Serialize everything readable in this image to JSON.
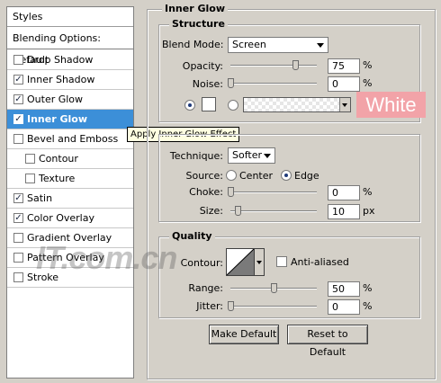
{
  "sidebar": {
    "header": "Styles",
    "blending": "Blending Options: Default",
    "items": [
      {
        "label": "Drop Shadow",
        "checked": false
      },
      {
        "label": "Inner Shadow",
        "checked": true
      },
      {
        "label": "Outer Glow",
        "checked": true
      },
      {
        "label": "Inner Glow",
        "checked": true,
        "selected": true
      },
      {
        "label": "Bevel and Emboss",
        "checked": false
      },
      {
        "label": "Contour",
        "checked": false
      },
      {
        "label": "Texture",
        "checked": false
      },
      {
        "label": "Satin",
        "checked": true
      },
      {
        "label": "Color Overlay",
        "checked": true
      },
      {
        "label": "Gradient Overlay",
        "checked": false
      },
      {
        "label": "Pattern Overlay",
        "checked": false
      },
      {
        "label": "Stroke",
        "checked": false
      }
    ],
    "check_mark": "✓"
  },
  "tooltip": "Apply Inner Glow Effect",
  "panel": {
    "title": "Inner Glow",
    "structure": {
      "title": "Structure",
      "blend_mode_label": "Blend Mode:",
      "blend_mode_value": "Screen",
      "opacity_label": "Opacity:",
      "opacity_value": "75",
      "opacity_unit": "%",
      "opacity_fraction": 0.75,
      "noise_label": "Noise:",
      "noise_value": "0",
      "noise_unit": "%",
      "noise_fraction": 0.0,
      "color_annotation": "White",
      "color_swatch": "#ffffff"
    },
    "elements": {
      "technique_label": "Technique:",
      "technique_value": "Softer",
      "source_label": "Source:",
      "source_center": "Center",
      "source_edge": "Edge",
      "choke_label": "Choke:",
      "choke_value": "0",
      "choke_unit": "%",
      "choke_fraction": 0.0,
      "size_label": "Size:",
      "size_value": "10",
      "size_unit": "px"
    },
    "quality": {
      "title": "Quality",
      "contour_label": "Contour:",
      "anti_aliased_label": "Anti-aliased",
      "range_label": "Range:",
      "range_value": "50",
      "range_unit": "%",
      "range_fraction": 0.5,
      "jitter_label": "Jitter:",
      "jitter_value": "0",
      "jitter_unit": "%",
      "jitter_fraction": 0.0
    },
    "buttons": {
      "make_default": "Make Default",
      "reset_default": "Reset to Default"
    }
  },
  "watermark": "IT.com.cn",
  "colors": {
    "selection": "#3c8fd8",
    "annotation_bg": "#f2a3a8"
  }
}
